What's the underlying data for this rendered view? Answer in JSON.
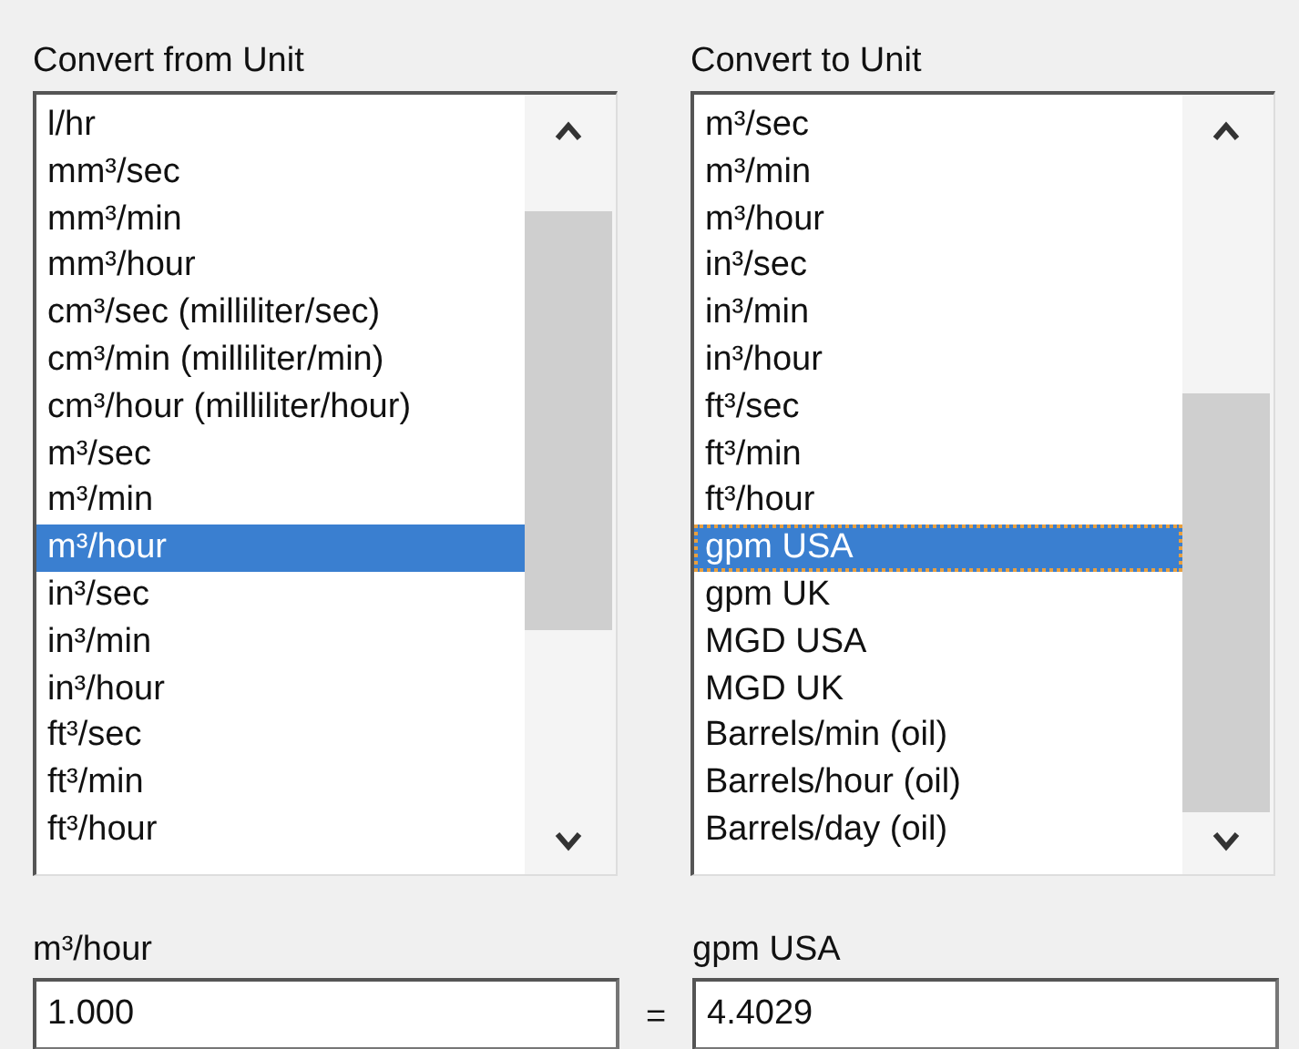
{
  "from_list": {
    "label": "Convert from Unit",
    "focused": false,
    "items": [
      {
        "text": "l/hr",
        "selected": false
      },
      {
        "text": "mm³/sec",
        "selected": false
      },
      {
        "text": "mm³/min",
        "selected": false
      },
      {
        "text": "mm³/hour",
        "selected": false
      },
      {
        "text": "cm³/sec (milliliter/sec)",
        "selected": false
      },
      {
        "text": "cm³/min (milliliter/min)",
        "selected": false
      },
      {
        "text": "cm³/hour (milliliter/hour)",
        "selected": false
      },
      {
        "text": "m³/sec",
        "selected": false
      },
      {
        "text": "m³/min",
        "selected": false
      },
      {
        "text": "m³/hour",
        "selected": true
      },
      {
        "text": "in³/sec",
        "selected": false
      },
      {
        "text": "in³/min",
        "selected": false
      },
      {
        "text": "in³/hour",
        "selected": false
      },
      {
        "text": "ft³/sec",
        "selected": false
      },
      {
        "text": "ft³/min",
        "selected": false
      },
      {
        "text": "ft³/hour",
        "selected": false
      }
    ]
  },
  "to_list": {
    "label": "Convert to Unit",
    "focused": true,
    "items": [
      {
        "text": "m³/sec",
        "selected": false
      },
      {
        "text": "m³/min",
        "selected": false
      },
      {
        "text": "m³/hour",
        "selected": false
      },
      {
        "text": "in³/sec",
        "selected": false
      },
      {
        "text": "in³/min",
        "selected": false
      },
      {
        "text": "in³/hour",
        "selected": false
      },
      {
        "text": "ft³/sec",
        "selected": false
      },
      {
        "text": "ft³/min",
        "selected": false
      },
      {
        "text": "ft³/hour",
        "selected": false
      },
      {
        "text": "gpm USA",
        "selected": true
      },
      {
        "text": "gpm UK",
        "selected": false
      },
      {
        "text": "MGD USA",
        "selected": false
      },
      {
        "text": "MGD UK",
        "selected": false
      },
      {
        "text": "Barrels/min (oil)",
        "selected": false
      },
      {
        "text": "Barrels/hour (oil)",
        "selected": false
      },
      {
        "text": "Barrels/day (oil)",
        "selected": false
      }
    ]
  },
  "from_value": {
    "label": "m³/hour",
    "value": "1.000"
  },
  "equals": "=",
  "to_value": {
    "label": "gpm USA",
    "value": "4.4029"
  }
}
